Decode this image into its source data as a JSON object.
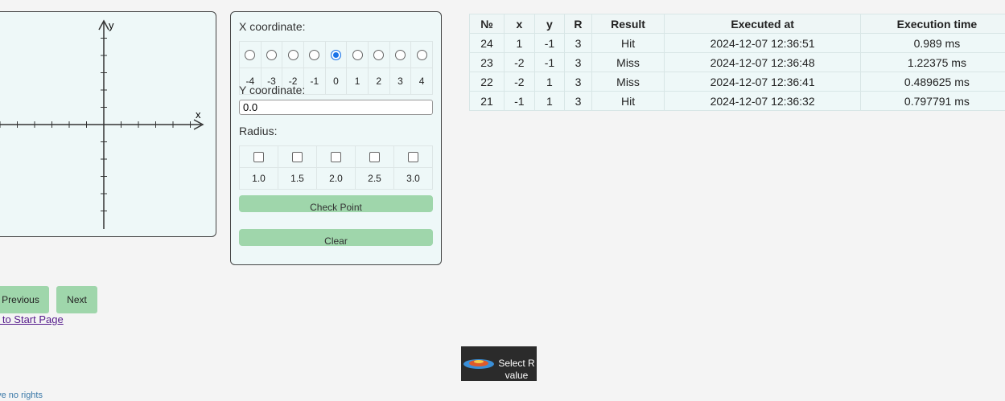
{
  "graph": {
    "x_label": "x",
    "y_label": "y"
  },
  "form": {
    "x_label": "X coordinate:",
    "x_options": [
      "-4",
      "-3",
      "-2",
      "-1",
      "0",
      "1",
      "2",
      "3",
      "4"
    ],
    "x_selected": "0",
    "y_label": "Y coordinate:",
    "y_value": "0.0",
    "r_label": "Radius:",
    "r_options": [
      "1.0",
      "1.5",
      "2.0",
      "2.5",
      "3.0"
    ],
    "check_button": "Check Point",
    "clear_button": "Clear"
  },
  "results": {
    "headers": [
      "№",
      "x",
      "y",
      "R",
      "Result",
      "Executed at",
      "Execution time"
    ],
    "rows": [
      [
        "24",
        "1",
        "-1",
        "3",
        "Hit",
        "2024-12-07 12:36:51",
        "0.989 ms"
      ],
      [
        "23",
        "-2",
        "-1",
        "3",
        "Miss",
        "2024-12-07 12:36:48",
        "1.22375 ms"
      ],
      [
        "22",
        "-2",
        "1",
        "3",
        "Miss",
        "2024-12-07 12:36:41",
        "0.489625 ms"
      ],
      [
        "21",
        "-1",
        "1",
        "3",
        "Hit",
        "2024-12-07 12:36:32",
        "0.797791 ms"
      ]
    ]
  },
  "pagination": {
    "previous": "Previous",
    "next": "Next"
  },
  "start_link": "o to Start Page",
  "tooltip": {
    "text": "Select R value",
    "icon": "globe-thumbnail-icon"
  },
  "footer": "ave no rights"
}
